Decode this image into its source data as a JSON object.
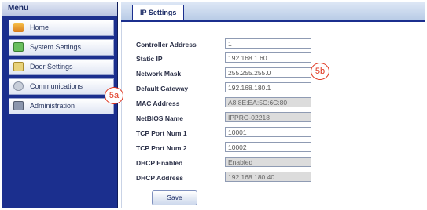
{
  "sidebar": {
    "title": "Menu",
    "items": [
      {
        "label": "Home",
        "icon": "home-icon"
      },
      {
        "label": "System Settings",
        "icon": "system-settings-icon"
      },
      {
        "label": "Door Settings",
        "icon": "door-icon"
      },
      {
        "label": "Communications",
        "icon": "communications-icon"
      },
      {
        "label": "Administration",
        "icon": "administration-icon"
      }
    ]
  },
  "tabs": [
    {
      "label": "IP Settings"
    }
  ],
  "form": {
    "fields": [
      {
        "label": "Controller Address",
        "value": "1",
        "readonly": false
      },
      {
        "label": "Static IP",
        "value": "192.168.1.60",
        "readonly": false
      },
      {
        "label": "Network Mask",
        "value": "255.255.255.0",
        "readonly": false
      },
      {
        "label": "Default Gateway",
        "value": "192.168.180.1",
        "readonly": false
      },
      {
        "label": "MAC Address",
        "value": "A8:8E:EA:5C:6C:80",
        "readonly": true
      },
      {
        "label": "NetBIOS Name",
        "value": "IPPRO-02218",
        "readonly": true
      },
      {
        "label": "TCP Port Num 1",
        "value": "10001",
        "readonly": false
      },
      {
        "label": "TCP Port Num 2",
        "value": "10002",
        "readonly": false
      },
      {
        "label": "DHCP Enabled",
        "value": "Enabled",
        "readonly": true
      },
      {
        "label": "DHCP Address",
        "value": "192.168.180.40",
        "readonly": true
      }
    ],
    "save_label": "Save"
  },
  "callouts": {
    "a": "5a",
    "b": "5b"
  },
  "colors": {
    "accent": "#1b2f8e",
    "callout": "#e0331c"
  }
}
